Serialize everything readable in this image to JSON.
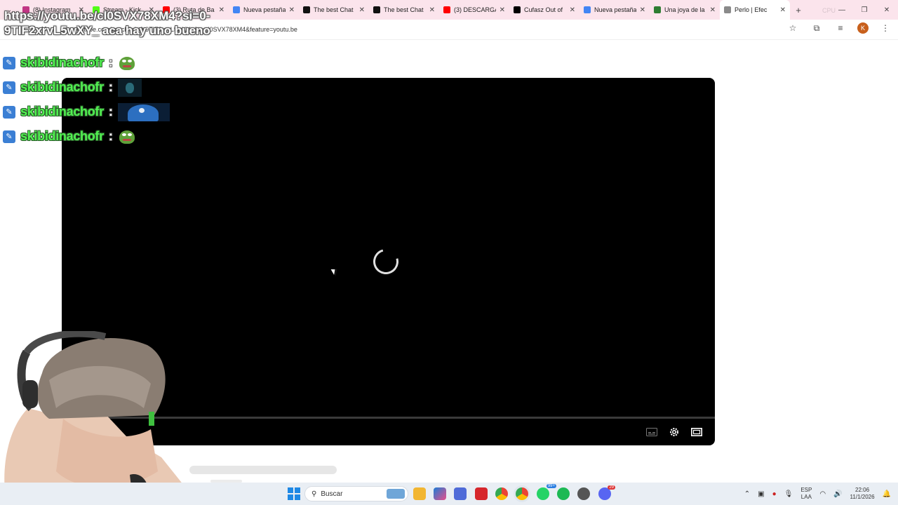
{
  "browser": {
    "tabs": [
      {
        "title": "(8) Instagram",
        "color": "#c13584"
      },
      {
        "title": "Stream - Kick",
        "color": "#53fc18"
      },
      {
        "title": "(3) Ruta de Ba",
        "color": "#ff0000"
      },
      {
        "title": "Nueva pestaña",
        "color": "#4285f4"
      },
      {
        "title": "The best Chat",
        "color": "#111111"
      },
      {
        "title": "The best Chat",
        "color": "#111111"
      },
      {
        "title": "(3) DESCARGA",
        "color": "#ff0000"
      },
      {
        "title": "Cufasz Out of",
        "color": "#000000"
      },
      {
        "title": "Nueva pestaña",
        "color": "#4285f4"
      },
      {
        "title": "Una joya de la",
        "color": "#2e7d32"
      },
      {
        "title": "Perlo | Efec",
        "color": "#8a8a8a"
      }
    ],
    "active_tab_index": 10,
    "url": "youtube.com/watch?si=0-9TIF2xrvL5wXY_&v=cl0SVX78XM4&feature=youtu.be",
    "overlay_cpu": "CPU"
  },
  "stream_overlay_text": "https://youtu.be/cl0SVX78XM4?si=0-9TIF2xrvL5wXY_ aca hay uno bueno",
  "chat": [
    {
      "username": "skibidinachofr",
      "separator": ":",
      "emote": "frog-emote"
    },
    {
      "username": "skibidinachofr",
      "separator": ":",
      "emote": "dark-creature-emote"
    },
    {
      "username": "skibidinachofr",
      "separator": ":",
      "emote": "blue-monster-emote"
    },
    {
      "username": "skibidinachofr",
      "separator": ":",
      "emote": "frog-emote"
    }
  ],
  "player": {
    "state": "loading",
    "controls": [
      "captions-icon",
      "settings-gear-icon",
      "theater-mode-icon"
    ]
  },
  "taskbar": {
    "search_placeholder": "Buscar",
    "language_top": "ESP",
    "language_bottom": "LAA",
    "time": "22:06",
    "date": "11/1/2026",
    "whatsapp_badge": "99+",
    "discord_badge": "29"
  }
}
